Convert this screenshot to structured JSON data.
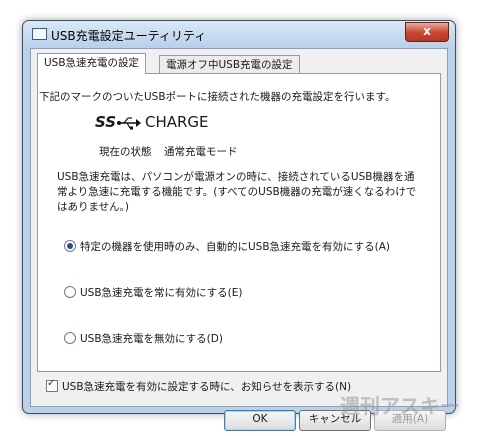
{
  "window": {
    "title": "USB充電設定ユーティリティ",
    "close_label": "x"
  },
  "tabs": [
    {
      "label": "USB急速充電の設定"
    },
    {
      "label": "電源オフ中USB充電の設定"
    }
  ],
  "panel": {
    "description": "下記のマークのついたUSBポートに接続された機器の充電設定を行います。",
    "logo": {
      "ss": "SS",
      "text": "CHARGE"
    },
    "status_label": "現在の状態",
    "status_value": "通常充電モード",
    "info": "USB急速充電は、パソコンが電源オンの時に、接続されているUSB機器を通常より急速に充電する機能です。(すべてのUSB機器の充電が速くなるわけではありません。)",
    "options": [
      {
        "label": "特定の機器を使用時のみ、自動的にUSB急速充電を有効にする(A)",
        "selected": true
      },
      {
        "label": "USB急速充電を常に有効にする(E)",
        "selected": false
      },
      {
        "label": "USB急速充電を無効にする(D)",
        "selected": false
      }
    ],
    "notify_checkbox": {
      "label": "USB急速充電を有効に設定する時に、お知らせを表示する(N)",
      "checked": true
    }
  },
  "buttons": {
    "ok": "OK",
    "cancel": "キャンセル",
    "apply": "適用(A)"
  },
  "watermark": "週刊アスキー"
}
